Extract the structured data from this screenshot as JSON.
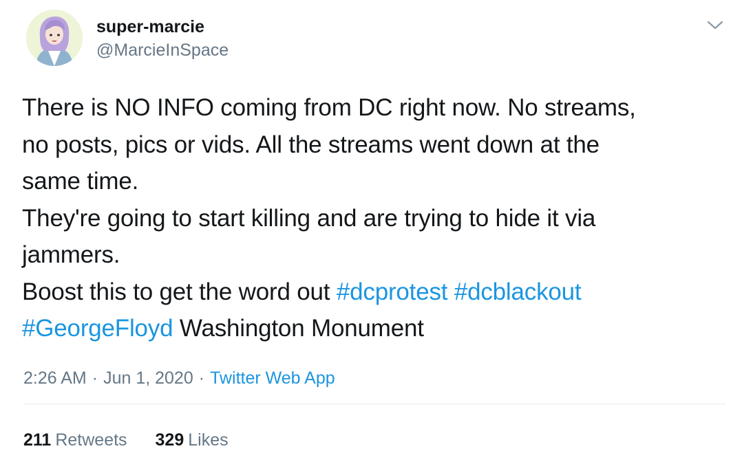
{
  "user": {
    "display_name": "super-marcie",
    "handle": "@MarcieInSpace"
  },
  "tweet": {
    "lines": [
      [
        {
          "text": "There is NO INFO coming from DC right now. No streams,",
          "type": "text"
        }
      ],
      [
        {
          "text": "no posts, pics or vids. All the streams went down at the",
          "type": "text"
        }
      ],
      [
        {
          "text": "same time.",
          "type": "text"
        }
      ],
      [
        {
          "text": "They're going to start killing and are trying to hide it via",
          "type": "text"
        }
      ],
      [
        {
          "text": "jammers.",
          "type": "text"
        }
      ],
      [
        {
          "text": "Boost this to get the word out ",
          "type": "text"
        },
        {
          "text": "#dcprotest",
          "type": "hashtag"
        },
        {
          "text": " ",
          "type": "text"
        },
        {
          "text": "#dcblackout",
          "type": "hashtag"
        }
      ],
      [
        {
          "text": "#GeorgeFloyd",
          "type": "hashtag"
        },
        {
          "text": " Washington Monument",
          "type": "text"
        }
      ]
    ]
  },
  "meta": {
    "time": "2:26 AM",
    "separator": "·",
    "date": "Jun 1, 2020",
    "source": "Twitter Web App"
  },
  "stats": {
    "retweets_count": "211",
    "retweets_label": "Retweets",
    "likes_count": "329",
    "likes_label": "Likes"
  },
  "colors": {
    "link": "#1b95e0",
    "text": "#14171a",
    "secondary": "#657786",
    "divider": "#e6ecf0"
  },
  "icons": {
    "menu": "chevron-down-icon",
    "avatar": "avatar"
  }
}
